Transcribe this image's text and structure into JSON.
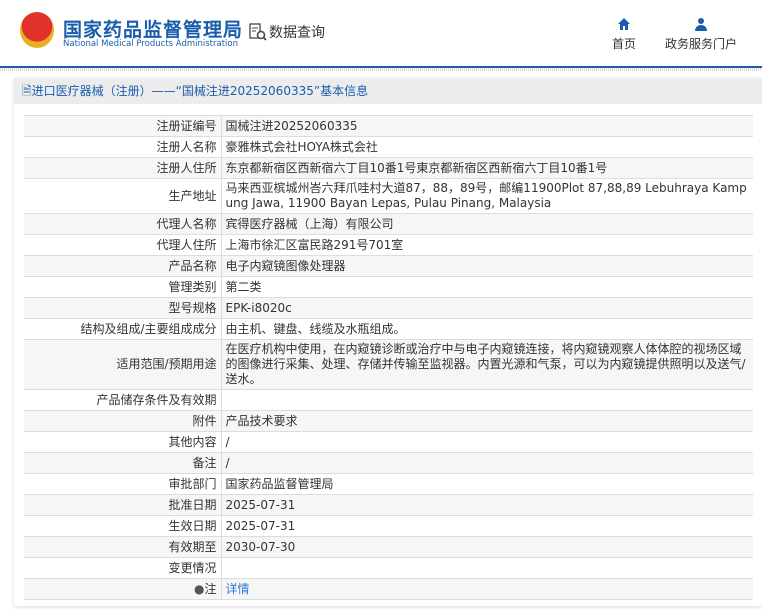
{
  "header": {
    "logo_cn": "国家药品监督管理局",
    "logo_en": "National Medical Products Administration",
    "data_query": "数据查询",
    "nav": [
      {
        "label": "首页",
        "icon": "home-icon"
      },
      {
        "label": "政务服务门户",
        "icon": "user-icon"
      }
    ]
  },
  "panel": {
    "title": "进口医疗器械（注册）——“国械注进20252060335”基本信息"
  },
  "rows": [
    {
      "label": "注册证编号",
      "value": "国械注进20252060335"
    },
    {
      "label": "注册人名称",
      "value": "豪雅株式会社HOYA株式会社"
    },
    {
      "label": "注册人住所",
      "value": "东京都新宿区西新宿六丁目10番1号東京都新宿区西新宿六丁目10番1号"
    },
    {
      "label": "生产地址",
      "value": "马来西亚槟城州峇六拜爪哇村大道87，88，89号，邮编11900Plot 87,88,89 Lebuhraya Kampung Jawa, 11900 Bayan Lepas, Pulau Pinang, Malaysia"
    },
    {
      "label": "代理人名称",
      "value": "宾得医疗器械（上海）有限公司"
    },
    {
      "label": "代理人住所",
      "value": "上海市徐汇区富民路291号701室"
    },
    {
      "label": "产品名称",
      "value": "电子内窥镜图像处理器"
    },
    {
      "label": "管理类别",
      "value": "第二类"
    },
    {
      "label": "型号规格",
      "value": "EPK-i8020c"
    },
    {
      "label": "结构及组成/主要组成成分",
      "value": "由主机、键盘、线缆及水瓶组成。"
    },
    {
      "label": "适用范围/预期用途",
      "value": "在医疗机构中使用，在内窥镜诊断或治疗中与电子内窥镜连接，将内窥镜观察人体体腔的视场区域的图像进行采集、处理、存储并传输至监视器。内置光源和气泵，可以为内窥镜提供照明以及送气/送水。"
    },
    {
      "label": "产品储存条件及有效期",
      "value": ""
    },
    {
      "label": "附件",
      "value": "产品技术要求"
    },
    {
      "label": "其他内容",
      "value": "/"
    },
    {
      "label": "备注",
      "value": "/"
    },
    {
      "label": "审批部门",
      "value": "国家药品监督管理局"
    },
    {
      "label": "批准日期",
      "value": "2025-07-31"
    },
    {
      "label": "生效日期",
      "value": "2025-07-31"
    },
    {
      "label": "有效期至",
      "value": "2030-07-30"
    },
    {
      "label": "变更情况",
      "value": ""
    }
  ],
  "note": {
    "label": "注",
    "link": "详情"
  }
}
